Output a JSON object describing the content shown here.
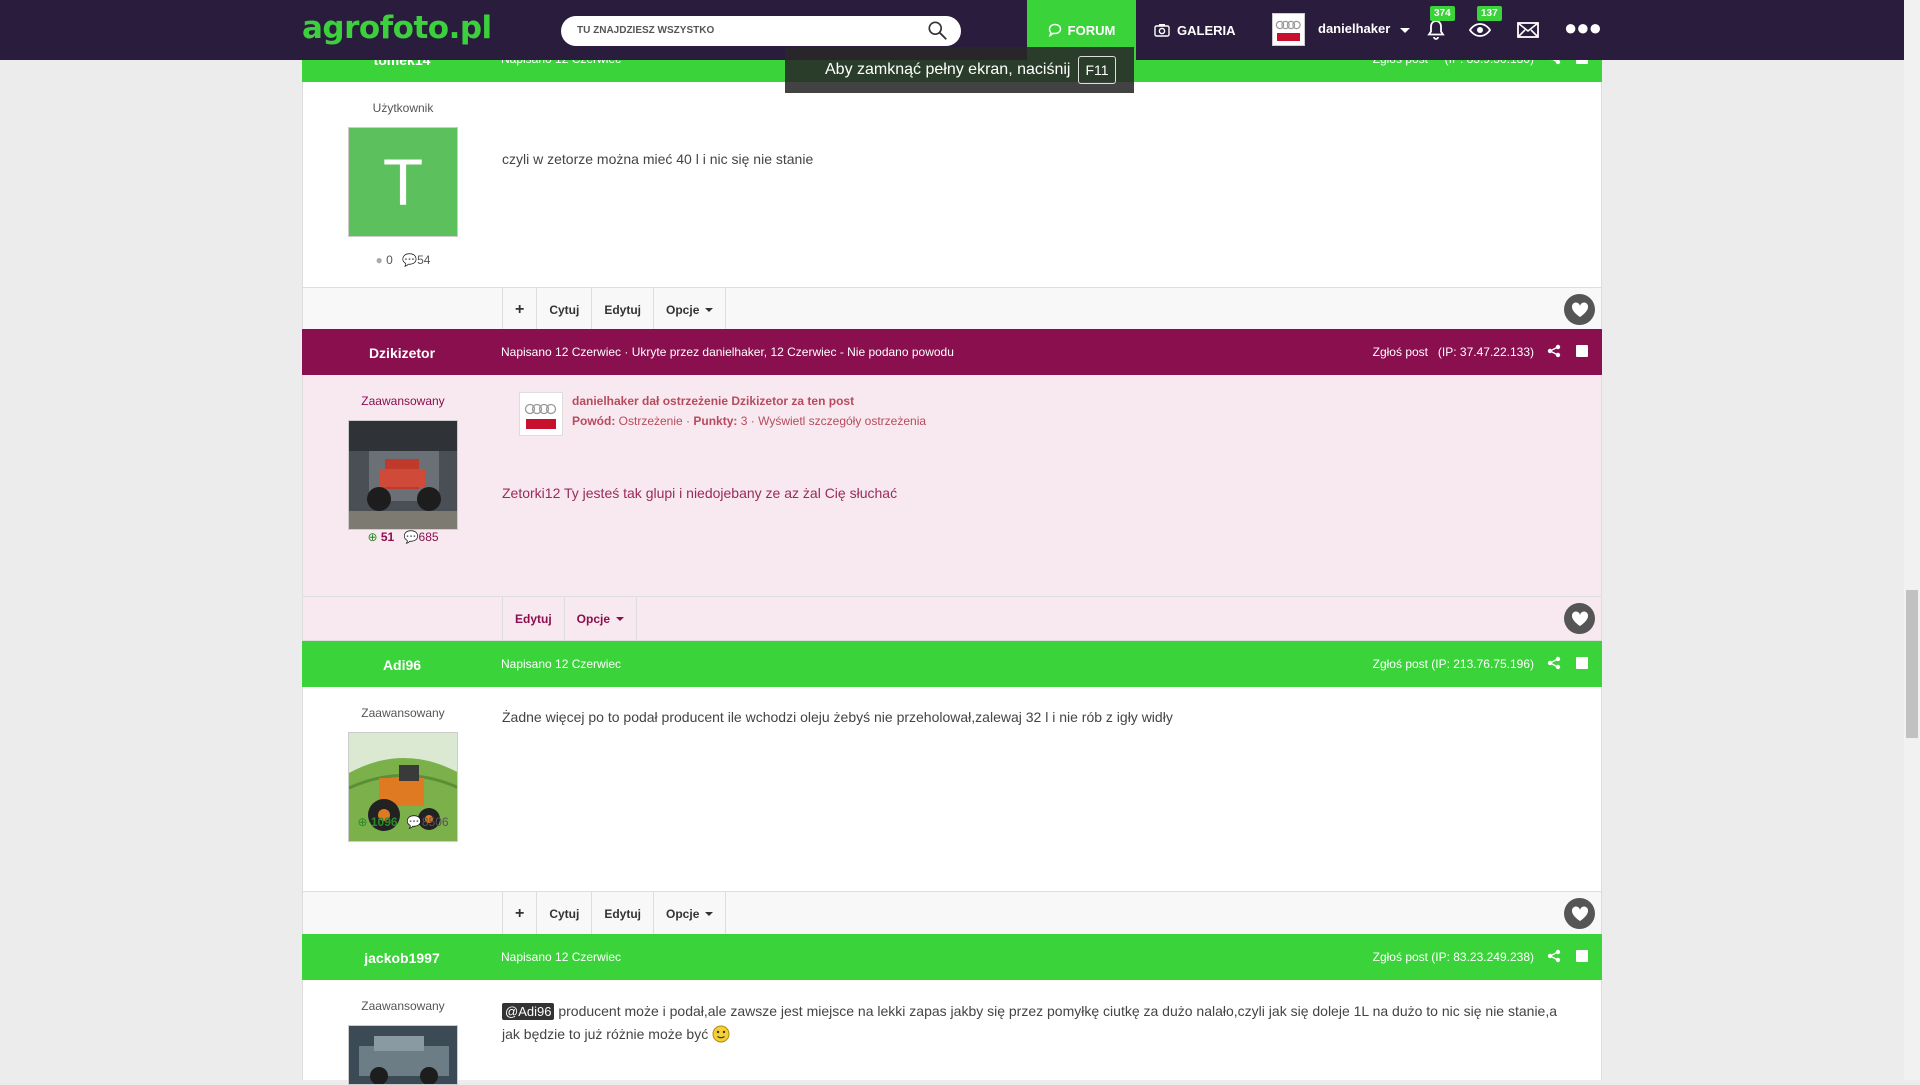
{
  "nav": {
    "logo": "agrofoto.pl",
    "search_placeholder": "TU ZNAJDZIESZ WSZYSTKO",
    "forum": "FORUM",
    "gallery": "GALERIA",
    "username": "danielhaker",
    "notifications_count": "374",
    "watched_count": "137"
  },
  "toast": {
    "text": "Aby zamknąć pełny ekran, naciśnij",
    "key": "F11"
  },
  "colors": {
    "green": "#3ad33a",
    "hidden_header": "#8a0f4e",
    "hidden_bg": "#f7e9ef"
  },
  "footer_buttons": {
    "plus": "+",
    "quote": "Cytuj",
    "edit": "Edytuj",
    "options": "Opcje"
  },
  "posts": [
    {
      "author": "tomek14",
      "meta": "Napisano 12 Czerwiec",
      "report": "Zgłoś post",
      "ip": "(IP: 83.9.30.180)",
      "role": "Użytkownik",
      "avatar_letter": "T",
      "rep": "0",
      "posts": "54",
      "text": "czyli w zetorze można mieć 40 l i nic się nie stanie"
    },
    {
      "author": "Dzikizetor",
      "meta": "Napisano 12 Czerwiec · Ukryte przez danielhaker, 12 Czerwiec - Nie podano powodu",
      "report": "Zgłoś post",
      "ip": "(IP: 37.47.22.133)",
      "role": "Zaawansowany",
      "rep": "51",
      "posts": "685",
      "warning": {
        "title": "danielhaker dał ostrzeżenie Dzikizetor za ten post",
        "reason_label": "Powód:",
        "reason": "Ostrzeżenie",
        "points_label": "Punkty:",
        "points": "3",
        "details": "Wyświetl szczegóły ostrzeżenia"
      },
      "text": "Zetorki12 Ty jesteś tak glupi i niedojebany ze az żal Cię słuchać"
    },
    {
      "author": "Adi96",
      "meta": "Napisano 12 Czerwiec",
      "report": "Zgłoś post",
      "ip": "(IP: 213.76.75.196)",
      "role": "Zaawansowany",
      "rep": "1096",
      "posts": "8506",
      "text": "Żadne więcej po to podał producent ile wchodzi oleju żebyś nie przeholował,zalewaj 32 l i nie rób z igły widły"
    },
    {
      "author": "jackob1997",
      "meta": "Napisano 12 Czerwiec",
      "report": "Zgłoś post",
      "ip": "(IP: 83.23.249.238)",
      "role": "Zaawansowany",
      "mention": "@Adi96",
      "text": "producent może i podał,ale zawsze jest miejsce na  lekki zapas jakby się przez pomyłkę ciutkę za dużo nalało,czyli jak się doleje 1L na dużo to nic się nie stanie,a jak będzie to już różnie może być"
    }
  ]
}
